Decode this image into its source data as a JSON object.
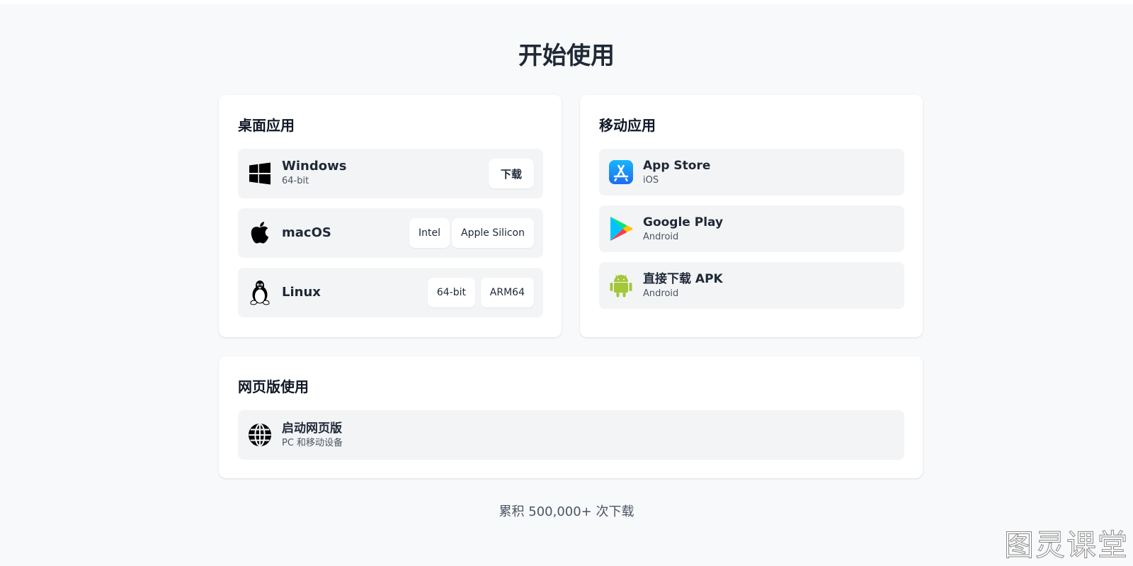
{
  "page": {
    "title": "开始使用",
    "stats": "累积 500,000+ 次下载",
    "watermark": "图灵课堂"
  },
  "desktop": {
    "title": "桌面应用",
    "items": [
      {
        "name": "Windows",
        "sub": "64-bit",
        "icon": "windows-icon",
        "buttons": [
          "下载"
        ]
      },
      {
        "name": "macOS",
        "sub": "",
        "icon": "apple-icon",
        "buttons": [
          "Intel",
          "Apple Silicon"
        ]
      },
      {
        "name": "Linux",
        "sub": "",
        "icon": "linux-tux-icon",
        "buttons": [
          "64-bit",
          "ARM64"
        ]
      }
    ]
  },
  "mobile": {
    "title": "移动应用",
    "items": [
      {
        "name": "App Store",
        "sub": "iOS",
        "icon": "app-store-icon"
      },
      {
        "name": "Google Play",
        "sub": "Android",
        "icon": "google-play-icon"
      },
      {
        "name": "直接下载 APK",
        "sub": "Android",
        "icon": "android-icon"
      }
    ]
  },
  "web": {
    "title": "网页版使用",
    "items": [
      {
        "name": "启动网页版",
        "sub": "PC 和移动设备",
        "icon": "globe-icon"
      }
    ]
  },
  "colors": {
    "background": "#f8f9fa",
    "card": "#ffffff",
    "row": "#f3f4f6",
    "text": "#1f2937",
    "muted": "#4b5563",
    "app_store_blue": "#1a8cf5",
    "android_green": "#a4c639"
  }
}
